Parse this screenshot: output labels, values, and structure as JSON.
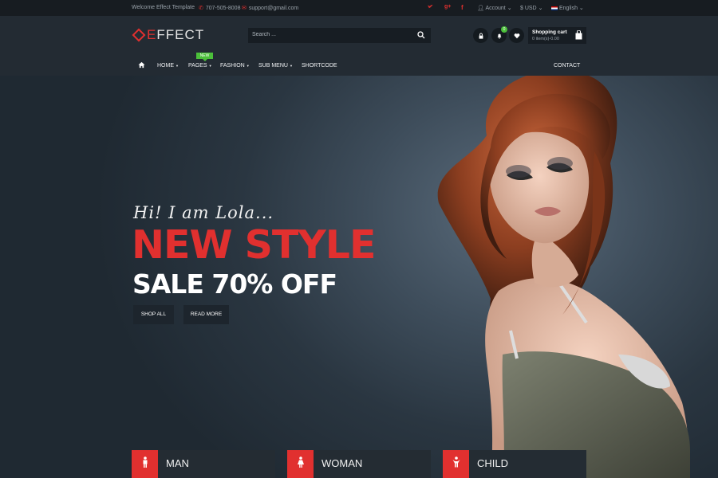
{
  "topbar": {
    "welcome": "Welcome Effect Template",
    "phone": "707-505-8008",
    "email": "support@gmail.com",
    "social": [
      "twitter-icon",
      "google-plus-icon",
      "facebook-icon"
    ],
    "account": "Account",
    "currency": "$ USD",
    "language": "English"
  },
  "header": {
    "logo_first": "E",
    "logo_rest": "FFECT",
    "search_placeholder": "Search ...",
    "notification_count": "0",
    "cart_title": "Shopping cart",
    "cart_summary": "0 item(s)-0.00"
  },
  "nav": {
    "items": [
      "HOME",
      "PAGES",
      "FASHION",
      "SUB MENU",
      "SHORTCODE",
      "CONTACT"
    ],
    "new_badge": "NEW"
  },
  "hero": {
    "script": "Hi! I am Lola...",
    "headline": "NEW STYLE",
    "sub": "SALE 70% OFF",
    "btn_shop": "SHOP ALL",
    "btn_read": "READ MORE"
  },
  "categories": [
    "MAN",
    "WOMAN",
    "CHILD"
  ],
  "colors": {
    "accent": "#e1302f",
    "new_badge": "#4bbf3a",
    "dark": "#232b33"
  }
}
